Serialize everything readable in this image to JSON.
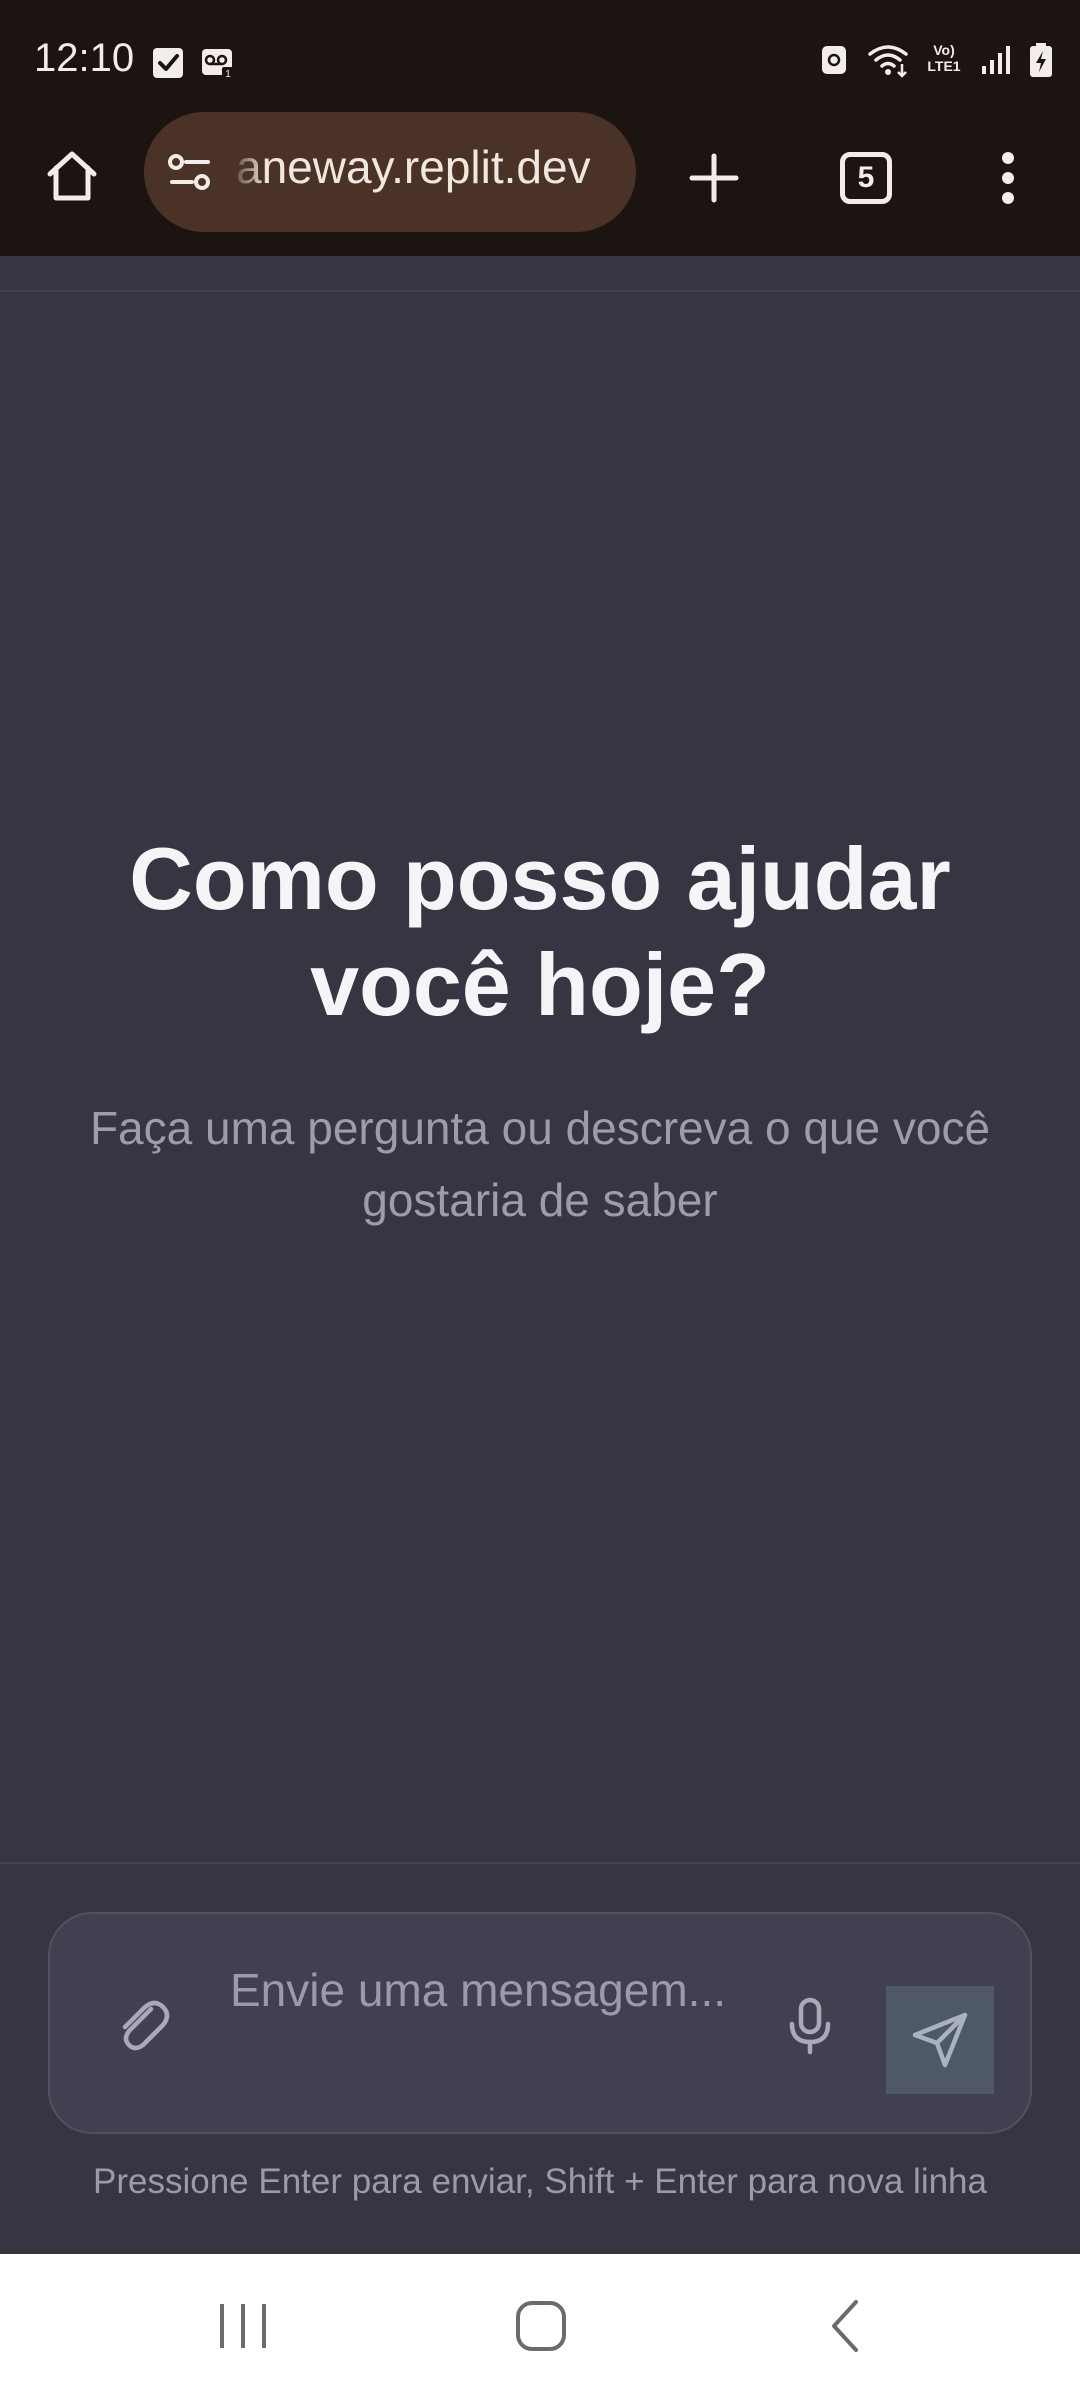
{
  "status_bar": {
    "time": "12:10",
    "left_icons": [
      "check-notification-icon",
      "voicemail-icon"
    ],
    "right_icons": [
      "vpn-icon",
      "wifi-icon",
      "volte-icon",
      "signal-icon",
      "battery-charging-icon"
    ],
    "volte_label": "Vo) LTE1"
  },
  "browser": {
    "url": "aneway.replit.dev",
    "tab_count": "5",
    "icons": {
      "home": "home-icon",
      "site_info": "site-settings-icon",
      "new_tab": "plus-icon",
      "tabs": "tab-switcher-icon",
      "menu": "more-vert-icon"
    },
    "colors": {
      "toolbar_bg": "#1c1411",
      "url_pill_bg": "#4a3326"
    }
  },
  "page": {
    "background": "#363643",
    "hero": {
      "title": "Como posso ajudar você hoje?",
      "subtitle": "Faça uma pergunta ou descreva o que você gostaria de saber"
    },
    "composer": {
      "placeholder": "Envie uma mensagem...",
      "value": "",
      "hint": "Pressione Enter para enviar, Shift + Enter para nova linha",
      "icons": {
        "attach": "paperclip-icon",
        "mic": "microphone-icon",
        "send": "send-icon"
      },
      "colors": {
        "composer_bg": "#404050",
        "send_bg": "#4f5869"
      }
    }
  },
  "nav_bar": {
    "icons": [
      "recent-apps-icon",
      "home-circle-icon",
      "back-icon"
    ]
  }
}
